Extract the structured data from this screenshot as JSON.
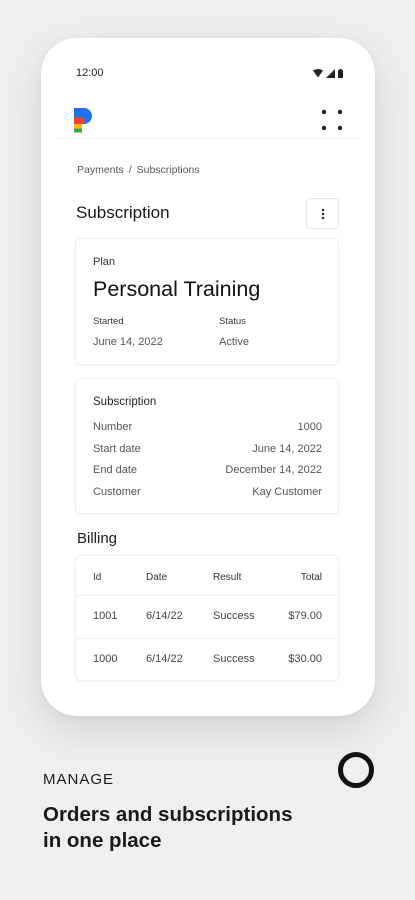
{
  "status_bar": {
    "time": "12:00"
  },
  "breadcrumb": {
    "parent": "Payments",
    "separator": "/",
    "current": "Subscriptions"
  },
  "page": {
    "title": "Subscription"
  },
  "plan": {
    "label": "Plan",
    "name": "Personal Training",
    "started_label": "Started",
    "started_value": "June 14, 2022",
    "status_label": "Status",
    "status_value": "Active"
  },
  "subscription": {
    "title": "Subscription",
    "rows": [
      {
        "label": "Number",
        "value": "1000"
      },
      {
        "label": "Start date",
        "value": "June 14, 2022"
      },
      {
        "label": "End date",
        "value": "December 14, 2022"
      },
      {
        "label": "Customer",
        "value": "Kay Customer"
      }
    ]
  },
  "billing": {
    "title": "Billing",
    "columns": [
      "Id",
      "Date",
      "Result",
      "Total"
    ],
    "rows": [
      {
        "id": "1001",
        "date": "6/14/22",
        "result": "Success",
        "total": "$79.00"
      },
      {
        "id": "1000",
        "date": "6/14/22",
        "result": "Success",
        "total": "$30.00"
      }
    ]
  },
  "caption": {
    "kicker": "MANAGE",
    "headline_line1": "Orders and subscriptions",
    "headline_line2": "in one place"
  },
  "icons": {
    "logo": "app-logo-icon",
    "menu": "apps-grid-icon",
    "more": "more-vertical-icon",
    "brand_mark": "ring-icon"
  },
  "colors": {
    "logo_blue": "#1a73e8",
    "logo_red": "#ea4335",
    "logo_yellow": "#fbbc04",
    "logo_green": "#34a853"
  }
}
